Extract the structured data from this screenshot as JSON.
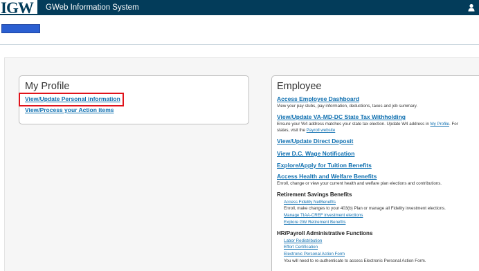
{
  "header": {
    "logo_text": "IGW",
    "system_title": "GWeb Information System",
    "user_icon": "user-icon"
  },
  "my_profile": {
    "title": "My Profile",
    "links": [
      "View/Update Personal information",
      "View/Process your Action items"
    ]
  },
  "employee": {
    "title": "Employee",
    "dashboard": {
      "link": "Access Employee Dashboard",
      "desc": "View your pay stubs, pay information, deductions, taxes and job summary."
    },
    "tax": {
      "link": "View/Update VA-MD-DC State Tax Withholding",
      "desc_1_pre": "Ensure your W4 address matches your state tax election. Update W4 address in ",
      "desc_1_link": "My Profile",
      "desc_1_post": ". For",
      "desc_2_pre": "states, visit the ",
      "desc_2_link": "Payroll website"
    },
    "direct_deposit": "View/Update Direct Deposit",
    "dc_wage": "View D.C. Wage Notification",
    "tuition": "Explore/Apply for Tuition Benefits",
    "health": {
      "link": "Access Health and Welfare Benefits",
      "desc": "Enroll, change or view your current health and welfare plan elections and contributions."
    },
    "retirement": {
      "heading": "Retirement Savings Benefits",
      "fidelity_link": "Access Fidelity NetBenefits",
      "fidelity_desc": "Enroll, make changes to your 403(b) Plan or manage all Fidelity investment elections.",
      "tiaa_link": "Manage TIAA-CREF investment elections",
      "gw_link": "Explore GW Retirement Benefits"
    },
    "hr": {
      "heading": "HR/Payroll Administrative Functions",
      "labor_link": "Labor Redistribution",
      "effort_link": "Effort Certification",
      "epaf_link": "Electronic Personal Action Form",
      "epaf_desc": "You will need to re-authenticate to access Electronic Personal Action Form."
    }
  },
  "colors": {
    "header_bg": "#033c5a",
    "link": "#0e6fb0",
    "highlight": "#e0131b",
    "tab": "#2b5fd1"
  }
}
